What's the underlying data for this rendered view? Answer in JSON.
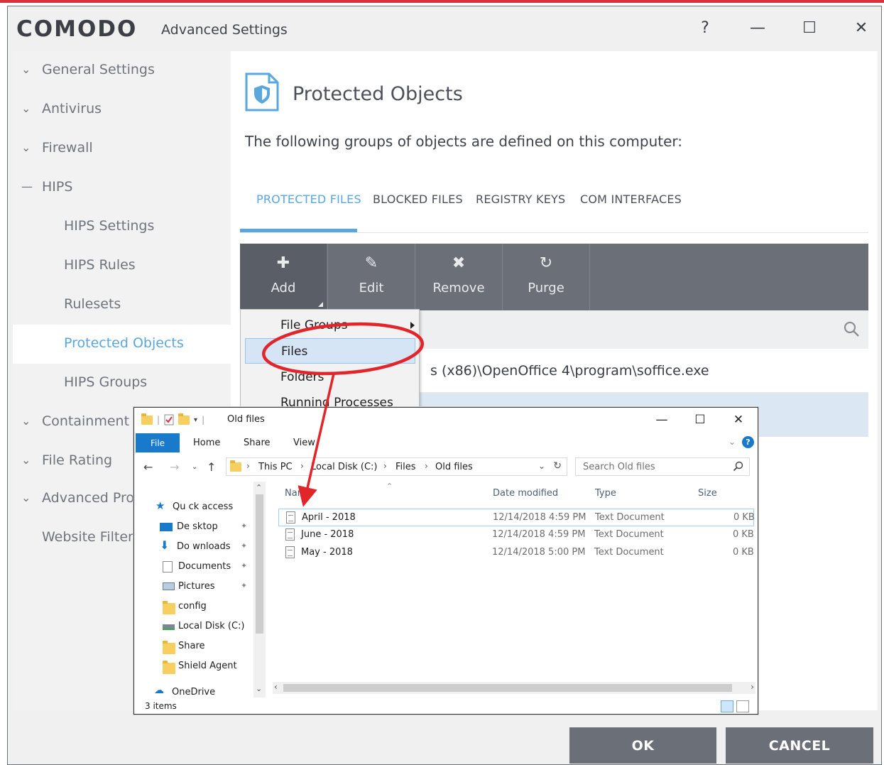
{
  "app": {
    "logo": "COMODO",
    "title": "Advanced Settings",
    "help": "?",
    "minimize": "—",
    "maximize": "☐",
    "close": "✕"
  },
  "sidebar": {
    "items": [
      {
        "label": "General Settings",
        "chevron": "⌄"
      },
      {
        "label": "Antivirus",
        "chevron": "⌄"
      },
      {
        "label": "Firewall",
        "chevron": "⌄"
      },
      {
        "label": "HIPS",
        "chevron": "—"
      },
      {
        "label": "HIPS Settings"
      },
      {
        "label": "HIPS Rules"
      },
      {
        "label": "Rulesets"
      },
      {
        "label": "Protected Objects"
      },
      {
        "label": "HIPS Groups"
      },
      {
        "label": "Containment",
        "chevron": "⌄"
      },
      {
        "label": "File Rating",
        "chevron": "⌄"
      },
      {
        "label": "Advanced Pro",
        "chevron": "⌄"
      },
      {
        "label": "Website Filteri"
      }
    ]
  },
  "main": {
    "title": "Protected Objects",
    "description": "The following groups of objects are defined on this computer:",
    "tabs": [
      "PROTECTED FILES",
      "BLOCKED FILES",
      "REGISTRY KEYS",
      "COM INTERFACES"
    ],
    "toolbar": [
      {
        "label": "Add",
        "icon": "✚"
      },
      {
        "label": "Edit",
        "icon": "✎"
      },
      {
        "label": "Remove",
        "icon": "✖"
      },
      {
        "label": "Purge",
        "icon": "↻"
      }
    ],
    "rows": [
      "s (x86)\\OpenOffice 4\\program\\soffice.exe"
    ]
  },
  "context_menu": {
    "items": [
      "File Groups",
      "Files",
      "Folders",
      "Running Processes"
    ]
  },
  "buttons": {
    "ok": "OK",
    "cancel": "CANCEL"
  },
  "explorer": {
    "title": "Old files",
    "ribbon_tabs": {
      "file": "File",
      "home": "Home",
      "share": "Share",
      "view": "View"
    },
    "help": "?",
    "breadcrumb": [
      "This PC",
      "Local Disk (C:)",
      "Files",
      "Old files"
    ],
    "search_placeholder": "Search Old files",
    "nav_items": [
      {
        "label": "Qu    ck access"
      },
      {
        "label": "De   sktop"
      },
      {
        "label": "Do   wnloads"
      },
      {
        "label": "Documents"
      },
      {
        "label": "Pictures"
      },
      {
        "label": "config"
      },
      {
        "label": "Local Disk (C:)"
      },
      {
        "label": "Share"
      },
      {
        "label": "Shield Agent"
      },
      {
        "label": "OneDrive"
      }
    ],
    "columns": {
      "name": "Name",
      "date": "Date modified",
      "type": "Type",
      "size": "Size"
    },
    "files": [
      {
        "name": "April - 2018",
        "date": "12/14/2018 4:59 PM",
        "type": "Text Document",
        "size": "0 KB"
      },
      {
        "name": "June - 2018",
        "date": "12/14/2018 4:59 PM",
        "type": "Text Document",
        "size": "0 KB"
      },
      {
        "name": "May - 2018",
        "date": "12/14/2018 5:00 PM",
        "type": "Text Document",
        "size": "0 KB"
      }
    ],
    "status": "3 items"
  },
  "colors": {
    "accent": "#5aa7de",
    "toolbar": "#6b6f78",
    "annotation": "#e2252b",
    "explorer_accent": "#1979ca"
  }
}
